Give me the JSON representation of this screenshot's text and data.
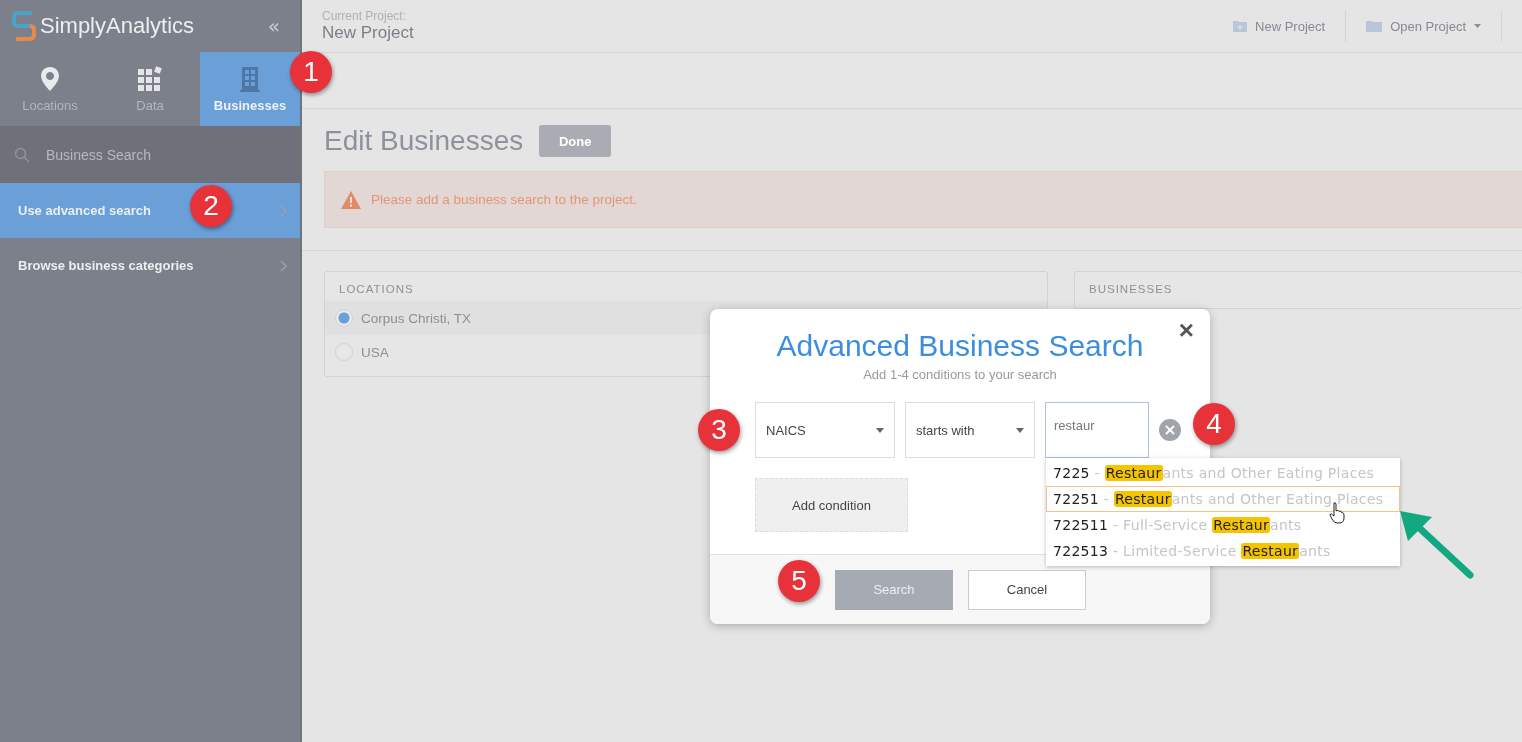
{
  "app": {
    "logo_text": "SimplyAnalytics",
    "collapse": "«"
  },
  "nav_tabs": [
    {
      "label": "Locations",
      "selected": false
    },
    {
      "label": "Data",
      "selected": false
    },
    {
      "label": "Businesses",
      "selected": true
    }
  ],
  "sidebar": {
    "search": {
      "placeholder": "Business Search"
    },
    "items": [
      {
        "label": "Use advanced search",
        "selected": true
      },
      {
        "label": "Browse business categories",
        "selected": false
      }
    ]
  },
  "header": {
    "project_label": "Current Project:",
    "project_name": "New Project",
    "actions": [
      {
        "label": "New Project"
      },
      {
        "label": "Open Project"
      }
    ]
  },
  "page": {
    "title": "Edit Businesses",
    "done_button": "Done",
    "warning": "Please add a business search to the project.",
    "locations": {
      "heading": "LOCATIONS",
      "items": [
        {
          "label": "Corpus Christi, TX",
          "selected": true
        },
        {
          "label": "USA",
          "selected": false
        }
      ]
    },
    "businesses": {
      "heading": "BUSINESSES"
    }
  },
  "dialog": {
    "title": "Advanced Business Search",
    "subtitle": "Add 1-4 conditions to your search",
    "close": "×",
    "field_select": "NAICS",
    "operator_select": "starts with",
    "value": "restaur",
    "suggestions": [
      {
        "code": "7225",
        "before": "- ",
        "match": "Restaur",
        "after": "ants and Other Eating Places",
        "selected": false
      },
      {
        "code": "72251",
        "before": "- ",
        "match": "Restaur",
        "after": "ants and Other Eating Places",
        "selected": true
      },
      {
        "code": "722511",
        "before": "- Full-Service ",
        "match": "Restaur",
        "after": "ants",
        "selected": false
      },
      {
        "code": "722513",
        "before": "- Limited-Service ",
        "match": "Restaur",
        "after": "ants",
        "selected": false
      }
    ],
    "add_condition": "Add condition",
    "search_button": "Search",
    "cancel_button": "Cancel"
  },
  "callouts": [
    "1",
    "2",
    "3",
    "4",
    "5"
  ]
}
